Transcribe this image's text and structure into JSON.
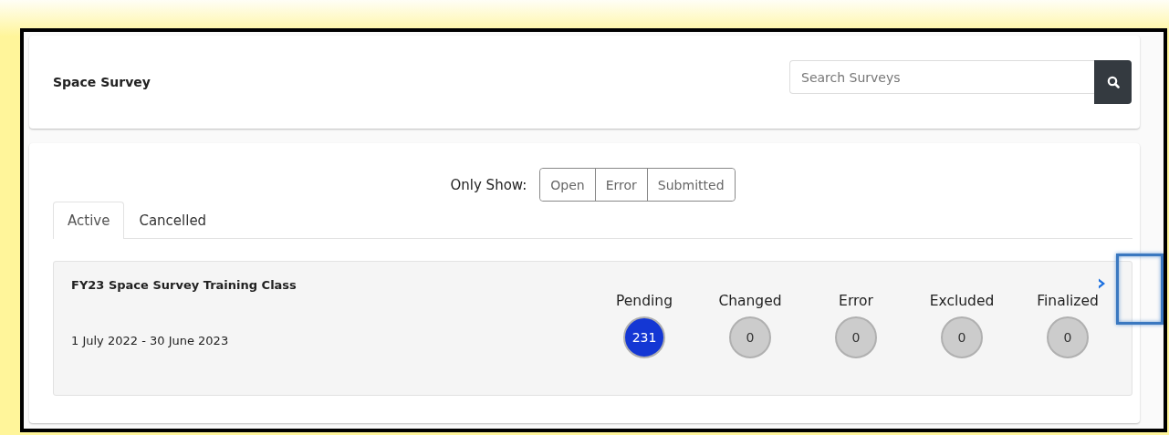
{
  "header": {
    "title": "Space Survey",
    "search": {
      "placeholder": "Search Surveys"
    }
  },
  "filter": {
    "label": "Only Show:",
    "options": [
      "Open",
      "Error",
      "Submitted"
    ]
  },
  "tabs": [
    {
      "label": "Active",
      "selected": true
    },
    {
      "label": "Cancelled",
      "selected": false
    }
  ],
  "surveys": [
    {
      "title": "FY23 Space Survey Training Class",
      "dates": "1 July 2022 - 30 June 2023",
      "statuses": [
        {
          "label": "Pending",
          "count": "231",
          "color": "#1437d4"
        },
        {
          "label": "Changed",
          "count": "0",
          "color": "#cccccc"
        },
        {
          "label": "Error",
          "count": "0",
          "color": "#cccccc"
        },
        {
          "label": "Excluded",
          "count": "0",
          "color": "#cccccc"
        },
        {
          "label": "Finalized",
          "count": "0",
          "color": "#cccccc"
        }
      ]
    }
  ]
}
